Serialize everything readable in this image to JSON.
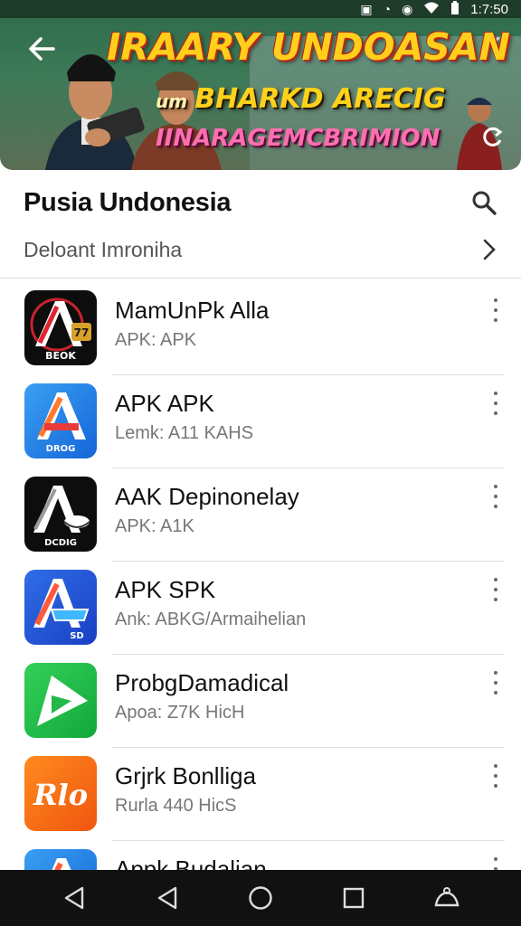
{
  "status_bar": {
    "time": "1:7:50"
  },
  "banner": {
    "title_line1": "IRAARY UNDOASAN",
    "title_line2_prefix": "um",
    "title_line2": "BHARKD ARECIG",
    "title_line3": "IINARAGEMCBRIMION"
  },
  "header": {
    "title": "Pusia Undonesia",
    "subtitle": "Deloant Imroniha"
  },
  "apps": [
    {
      "name": "MamUnPk Alla",
      "sub": "APK: APK",
      "icon_text": "BEOK",
      "icon_letter": "A"
    },
    {
      "name": "APK APK",
      "sub": "Lemk: A11 KAHS",
      "icon_text": "DROG",
      "icon_letter": "A"
    },
    {
      "name": "AAK Depinonelay",
      "sub": "APK: A1K",
      "icon_text": "DCDIG",
      "icon_letter": "A"
    },
    {
      "name": "APK SPK",
      "sub": "Ank: ABKG/Armaihelian",
      "icon_text": "SD",
      "icon_letter": "A"
    },
    {
      "name": "ProbgDamadical",
      "sub": "Apoa: Z7K HicH",
      "icon_text": "",
      "icon_letter": ""
    },
    {
      "name": "Grjrk Bonlliga",
      "sub": "Rurla 440 HicS",
      "icon_text": "",
      "icon_letter": "Rlo"
    },
    {
      "name": "Appk Budalian",
      "sub": "",
      "icon_text": "",
      "icon_letter": "A"
    }
  ],
  "colors": {
    "banner_green": "#2e6a49",
    "title_yellow": "#ffcf1c",
    "title_pink": "#ff6fb0",
    "nav_bar": "#111111"
  }
}
